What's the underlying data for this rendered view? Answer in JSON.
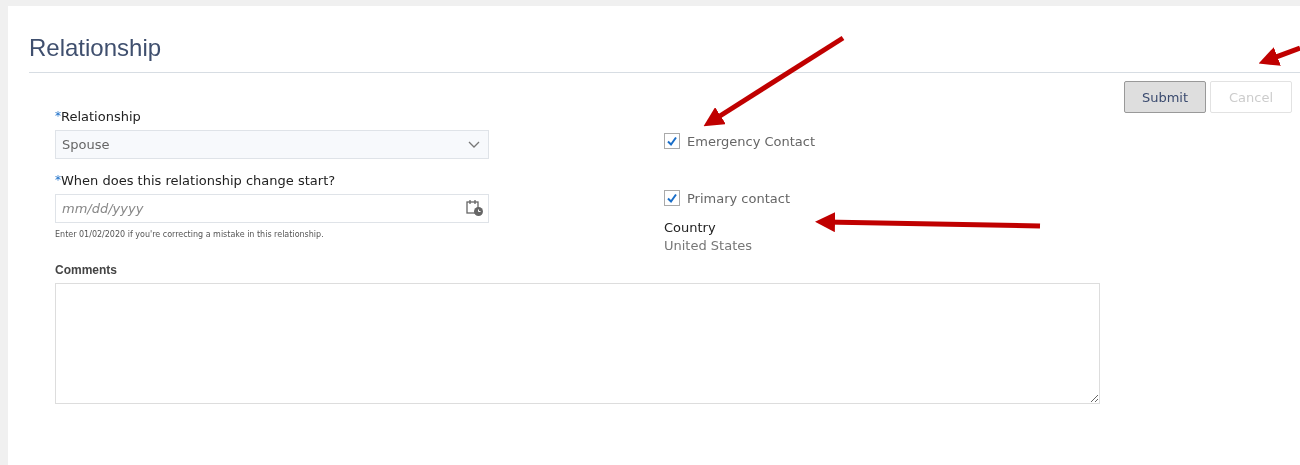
{
  "title": "Relationship",
  "buttons": [
    {
      "label": "Submit",
      "disabled": false
    },
    {
      "label": "Cancel",
      "disabled": true
    }
  ],
  "fields": [
    {
      "kind": "select",
      "mark": "*",
      "label": "Relationship",
      "value": "Spouse"
    },
    {
      "kind": "date",
      "mark": "*",
      "label": "When does this relationship change start?",
      "placeholder": "mm/dd/yyyy",
      "help": "Enter 01/02/2020 if you're correcting a mistake in this relationship."
    }
  ],
  "checkboxes": [
    {
      "label": "Emergency Contact",
      "checked": true
    },
    {
      "label": "Primary contact",
      "checked": true
    }
  ],
  "country": {
    "label": "Country",
    "value": "United States"
  },
  "comments": {
    "label": "Comments"
  }
}
